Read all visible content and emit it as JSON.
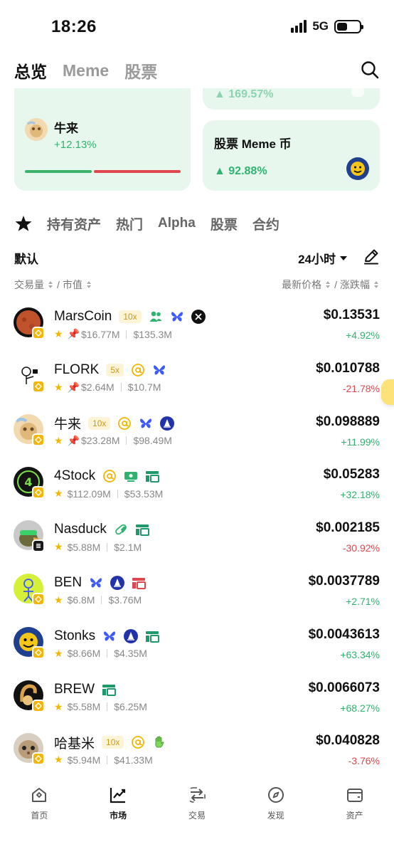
{
  "status_bar": {
    "time": "18:26",
    "network": "5G"
  },
  "top_nav": {
    "tabs": [
      {
        "label": "总览",
        "active": true
      },
      {
        "label": "Meme",
        "active": false
      },
      {
        "label": "股票",
        "active": false
      }
    ]
  },
  "cards": {
    "partial_change": "169.57%",
    "left": {
      "name": "牛来",
      "change": "+12.13%"
    },
    "right": {
      "name": "股票 Meme 币",
      "change": "92.88%"
    }
  },
  "category_tabs": [
    "持有资产",
    "热门",
    "Alpha",
    "股票",
    "合约"
  ],
  "sort": {
    "default_label": "默认",
    "timeframe": "24小时"
  },
  "columns": {
    "volume": "交易量",
    "slash": "/",
    "mcap": "市值",
    "price": "最新价格",
    "change": "涨跌幅"
  },
  "tokens": [
    {
      "name": "MarsCoin",
      "leverage": "10x",
      "volume": "$16.77M",
      "mcap": "$135.3M",
      "price": "$0.13531",
      "change": "+4.92%",
      "dir": "up"
    },
    {
      "name": "FLORK",
      "leverage": "5x",
      "volume": "$2.64M",
      "mcap": "$10.7M",
      "price": "$0.010788",
      "change": "-21.78%",
      "dir": "down"
    },
    {
      "name": "牛来",
      "leverage": "10x",
      "volume": "$23.28M",
      "mcap": "$98.49M",
      "price": "$0.098889",
      "change": "+11.99%",
      "dir": "up"
    },
    {
      "name": "4Stock",
      "leverage": "",
      "volume": "$112.09M",
      "mcap": "$53.53M",
      "price": "$0.05283",
      "change": "+32.18%",
      "dir": "up"
    },
    {
      "name": "Nasduck",
      "leverage": "",
      "volume": "$5.88M",
      "mcap": "$2.1M",
      "price": "$0.002185",
      "change": "-30.92%",
      "dir": "down"
    },
    {
      "name": "BEN",
      "leverage": "",
      "volume": "$6.8M",
      "mcap": "$3.76M",
      "price": "$0.0037789",
      "change": "+2.71%",
      "dir": "up"
    },
    {
      "name": "Stonks",
      "leverage": "",
      "volume": "$8.66M",
      "mcap": "$4.35M",
      "price": "$0.0043613",
      "change": "+63.34%",
      "dir": "up"
    },
    {
      "name": "BREW",
      "leverage": "",
      "volume": "$5.58M",
      "mcap": "$6.25M",
      "price": "$0.0066073",
      "change": "+68.27%",
      "dir": "up"
    },
    {
      "name": "哈基米",
      "leverage": "10x",
      "volume": "$5.94M",
      "mcap": "$41.33M",
      "price": "$0.040828",
      "change": "-3.76%",
      "dir": "down"
    }
  ],
  "bottom_nav": [
    {
      "label": "首页",
      "icon": "home-icon"
    },
    {
      "label": "市场",
      "icon": "chart-icon",
      "active": true
    },
    {
      "label": "交易",
      "icon": "swap-icon"
    },
    {
      "label": "发现",
      "icon": "compass-icon"
    },
    {
      "label": "资产",
      "icon": "wallet-icon"
    }
  ],
  "colors": {
    "up": "#2fb36f",
    "down": "#e0474c",
    "card_bg": "#e8f7ee",
    "accent_yellow": "#f2b705"
  }
}
